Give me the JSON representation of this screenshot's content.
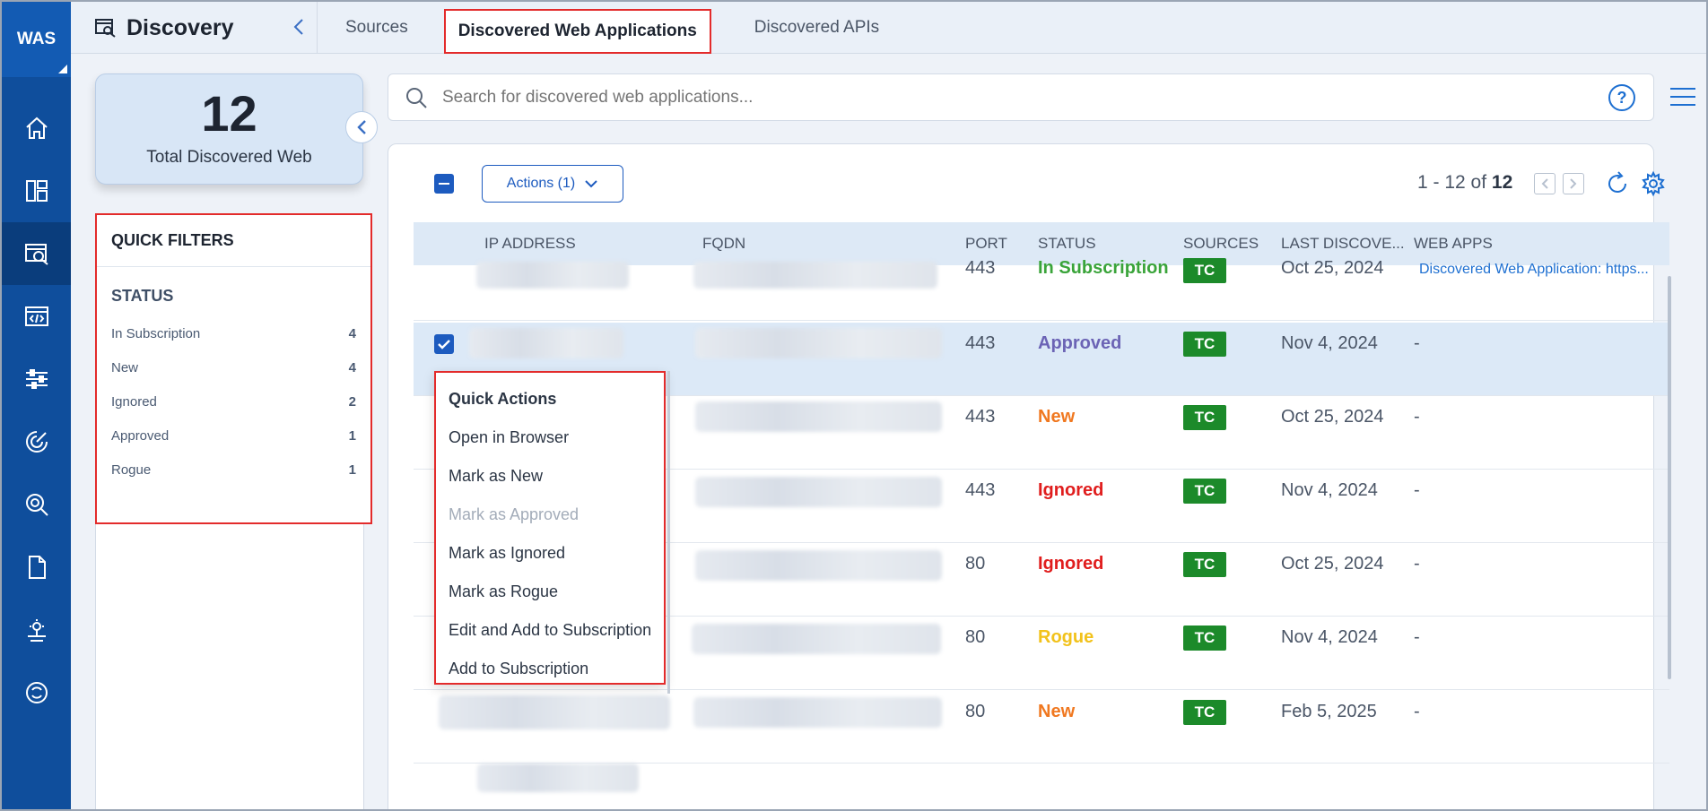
{
  "app": {
    "brand": "WAS",
    "page_title": "Discovery"
  },
  "tabs": [
    {
      "label": "Sources",
      "active": false
    },
    {
      "label": "Discovered Web Applications",
      "active": true
    },
    {
      "label": "Discovered APIs",
      "active": false
    }
  ],
  "rail_icons": [
    "home-icon",
    "dashboard-icon",
    "discovery-icon",
    "web-app-icon",
    "sliders-icon",
    "scan-icon",
    "detection-icon",
    "report-icon",
    "knowledgebase-icon",
    "integration-icon"
  ],
  "summary": {
    "count": "12",
    "label": "Total Discovered Web"
  },
  "quick_filters": {
    "title": "QUICK FILTERS",
    "section": "STATUS",
    "items": [
      {
        "label": "In Subscription",
        "count": "4"
      },
      {
        "label": "New",
        "count": "4"
      },
      {
        "label": "Ignored",
        "count": "2"
      },
      {
        "label": "Approved",
        "count": "1"
      },
      {
        "label": "Rogue",
        "count": "1"
      }
    ]
  },
  "search": {
    "placeholder": "Search for discovered web applications..."
  },
  "help_label": "?",
  "toolbar": {
    "actions_label": "Actions (1)"
  },
  "pager": {
    "range": "1 - 12 of",
    "total": "12"
  },
  "table": {
    "columns": [
      "IP ADDRESS",
      "FQDN",
      "PORT",
      "STATUS",
      "SOURCES",
      "LAST DISCOVE...",
      "WEB APPS"
    ],
    "rows": [
      {
        "port": "443",
        "status": "In Subscription",
        "source": "TC",
        "last": "Oct 25, 2024",
        "webapps": "Discovered Web Application: https..."
      },
      {
        "port": "443",
        "status": "Approved",
        "source": "TC",
        "last": "Nov 4, 2024",
        "webapps": "-",
        "selected": true
      },
      {
        "port": "443",
        "status": "New",
        "source": "TC",
        "last": "Oct 25, 2024",
        "webapps": "-"
      },
      {
        "port": "443",
        "status": "Ignored",
        "source": "TC",
        "last": "Nov 4, 2024",
        "webapps": "-"
      },
      {
        "port": "80",
        "status": "Ignored",
        "source": "TC",
        "last": "Oct 25, 2024",
        "webapps": "-"
      },
      {
        "port": "80",
        "status": "Rogue",
        "source": "TC",
        "last": "Nov 4, 2024",
        "webapps": "-"
      },
      {
        "port": "80",
        "status": "New",
        "source": "TC",
        "last": "Feb 5, 2025",
        "webapps": "-"
      }
    ]
  },
  "quick_actions": {
    "title": "Quick Actions",
    "items": [
      {
        "label": "Open in Browser",
        "disabled": false
      },
      {
        "label": "Mark as New",
        "disabled": false
      },
      {
        "label": "Mark as Approved",
        "disabled": true
      },
      {
        "label": "Mark as Ignored",
        "disabled": false
      },
      {
        "label": "Mark as Rogue",
        "disabled": false
      },
      {
        "label": "Edit and Add to Subscription",
        "disabled": false
      },
      {
        "label": "Add to Subscription",
        "disabled": false
      }
    ]
  },
  "colors": {
    "rail": "#0f4e9c",
    "accent": "#1d5bbf",
    "highlight_border": "#e32b2b",
    "status_in_subscription": "#3aa43a",
    "status_approved": "#6b63b5",
    "status_new": "#f07820",
    "status_ignored": "#e01d1d",
    "status_rogue": "#f2c21b",
    "badge": "#1c8a2a"
  }
}
